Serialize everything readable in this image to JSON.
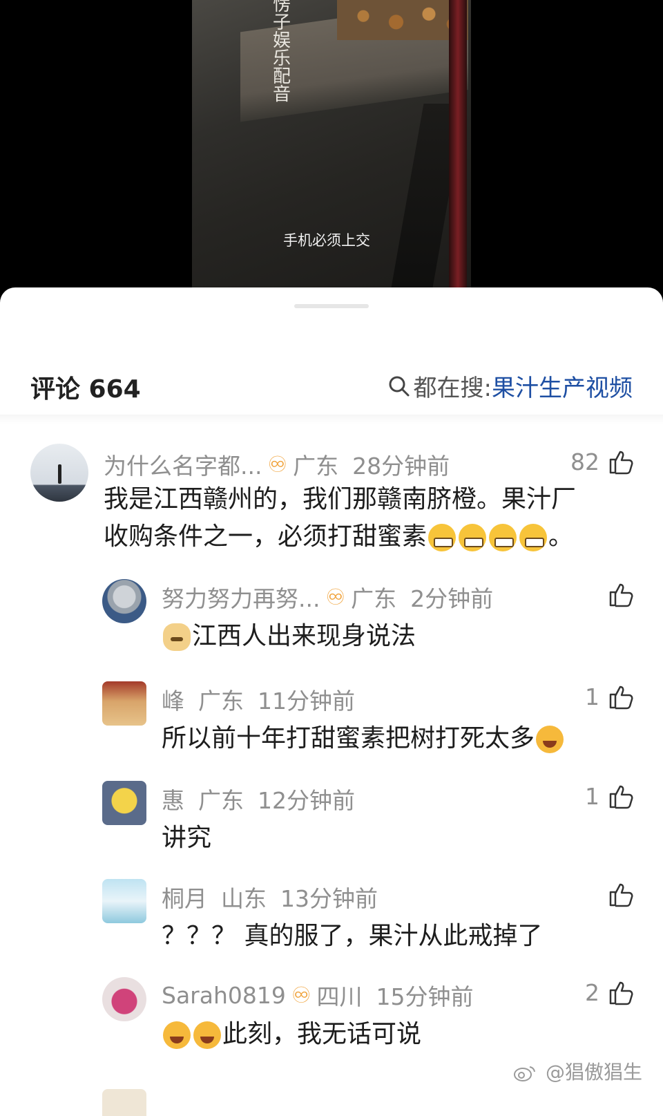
{
  "video": {
    "overlay_text": [
      "愣",
      "子",
      "娱",
      "乐",
      "配",
      "音"
    ],
    "subtitle": "手机必须上交"
  },
  "header": {
    "title": "评论 664",
    "search_prefix": "都在搜: ",
    "search_term": "果汁生产视频"
  },
  "comments": [
    {
      "name": "为什么名字都...",
      "badge": "♾",
      "location": "广东",
      "time": "28分钟前",
      "likes": "82",
      "text_line1": "我是江西赣州的，我们那赣南脐橙。果汁厂",
      "text_line2": "收购条件之一，必须打甜蜜素",
      "text_end": "。"
    },
    {
      "name": "努力努力再努...",
      "badge": "♾",
      "location": "广东",
      "time": "2分钟前",
      "likes": "",
      "text": "江西人出来现身说法"
    },
    {
      "name": "峰",
      "location": "广东",
      "time": "11分钟前",
      "likes": "1",
      "text": "所以前十年打甜蜜素把树打死太多"
    },
    {
      "name": "惠",
      "location": "广东",
      "time": "12分钟前",
      "likes": "1",
      "text": "讲究"
    },
    {
      "name": "桐月",
      "location": "山东",
      "time": "13分钟前",
      "likes": "",
      "text": "？？？ 真的服了，果汁从此戒掉了"
    },
    {
      "name": "Sarah0819",
      "badge": "♾",
      "location": "四川",
      "time": "15分钟前",
      "likes": "2",
      "text": "此刻，我无话可说"
    }
  ],
  "watermark": "@猖傲猖生",
  "colors": {
    "accent_link": "#1e4fa3",
    "meta_gray": "#8f8f8f",
    "badge_orange": "#f0a23a"
  }
}
